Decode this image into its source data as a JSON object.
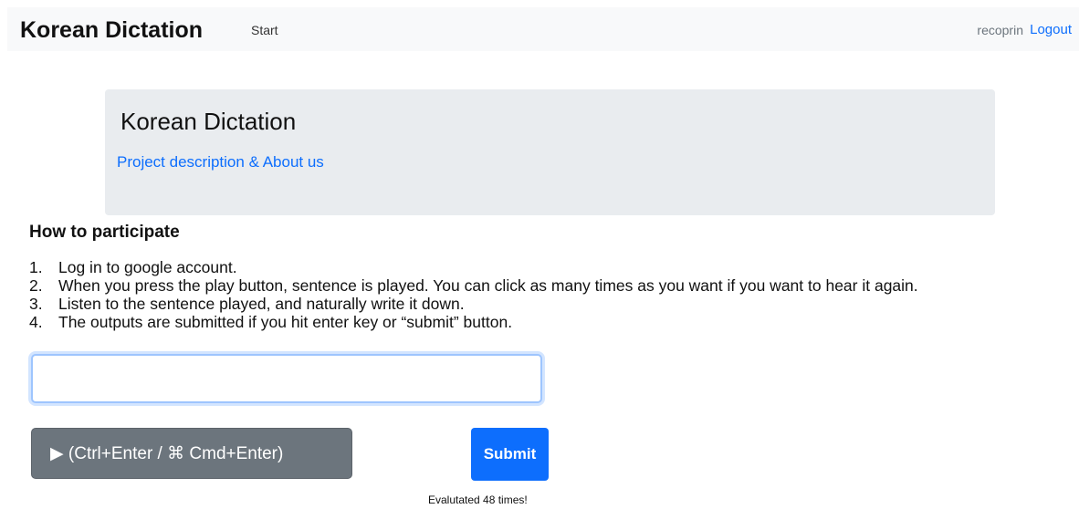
{
  "navbar": {
    "brand": "Korean Dictation",
    "start_link": "Start",
    "username": "recoprin",
    "logout_link": "Logout"
  },
  "jumbotron": {
    "title": "Korean Dictation",
    "link": "Project description & About us"
  },
  "instructions": {
    "title": "How to participate",
    "steps": [
      {
        "num": "1.",
        "text": "Log in to google account."
      },
      {
        "num": "2.",
        "text": "When you press the play button, sentence is played. You can click as many times as you want if you want to hear it again."
      },
      {
        "num": "3.",
        "text": "Listen to the sentence played, and naturally write it down."
      },
      {
        "num": "4.",
        "text": "The outputs are submitted if you hit enter key or “submit” button."
      }
    ]
  },
  "form": {
    "input_value": "",
    "play_label": "▶ (Ctrl+Enter / ⌘ Cmd+Enter)",
    "submit_label": "Submit",
    "eval_text": "Evalutated 48 times!"
  },
  "colors": {
    "primary": "#0d6efd",
    "secondary": "#6c757d",
    "navbar_bg": "#f8f9fa",
    "jumbotron_bg": "#e9ecef"
  }
}
